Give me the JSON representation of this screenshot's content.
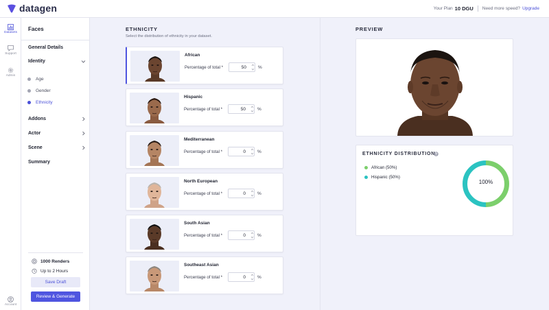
{
  "app": {
    "logo_text": "datagen"
  },
  "topbar": {
    "plan_label": "Your Plan",
    "plan_value": "10 DGU",
    "speed_text": "Need more speed?",
    "upgrade_label": "Upgrade"
  },
  "rail": {
    "datasets": "Datasets",
    "support": "Support",
    "admin": "Admin",
    "account": "Account"
  },
  "sidebar": {
    "title": "Faces",
    "sections": {
      "general_details": "General Details",
      "identity": "Identity",
      "addons": "Addons",
      "actor": "Actor",
      "scene": "Scene",
      "summary": "Summary"
    },
    "identity_items": [
      "Age",
      "Gender",
      "Ethnicity"
    ],
    "renders": "1000 Renders",
    "duration": "Up to 2 Hours",
    "save_draft": "Save Draft",
    "review_generate": "Review & Generate"
  },
  "ethnicity": {
    "heading": "ETHNICITY",
    "subheading": "Select the distribution of ethnicity in your dataset.",
    "field_label": "Percentage of total *",
    "percent_sign": "%",
    "items": [
      {
        "name": "African",
        "value": "50"
      },
      {
        "name": "Hispanic",
        "value": "50"
      },
      {
        "name": "Mediterranean",
        "value": "0"
      },
      {
        "name": "North European",
        "value": "0"
      },
      {
        "name": "South Asian",
        "value": "0"
      },
      {
        "name": "Southeast Asian",
        "value": "0"
      }
    ]
  },
  "preview": {
    "heading": "PREVIEW"
  },
  "distribution": {
    "heading": "ETHNICITY DISTRIBUTION",
    "legend": [
      "African (50%)",
      "Hispanic (50%)"
    ],
    "center_label": "100%",
    "shares": [
      50,
      50
    ],
    "colors": {
      "african": "#7ccf6c",
      "hispanic": "#2bc3c1"
    }
  },
  "colors": {
    "accent": "#4f55e0",
    "rail_active": "#4a50d8"
  }
}
